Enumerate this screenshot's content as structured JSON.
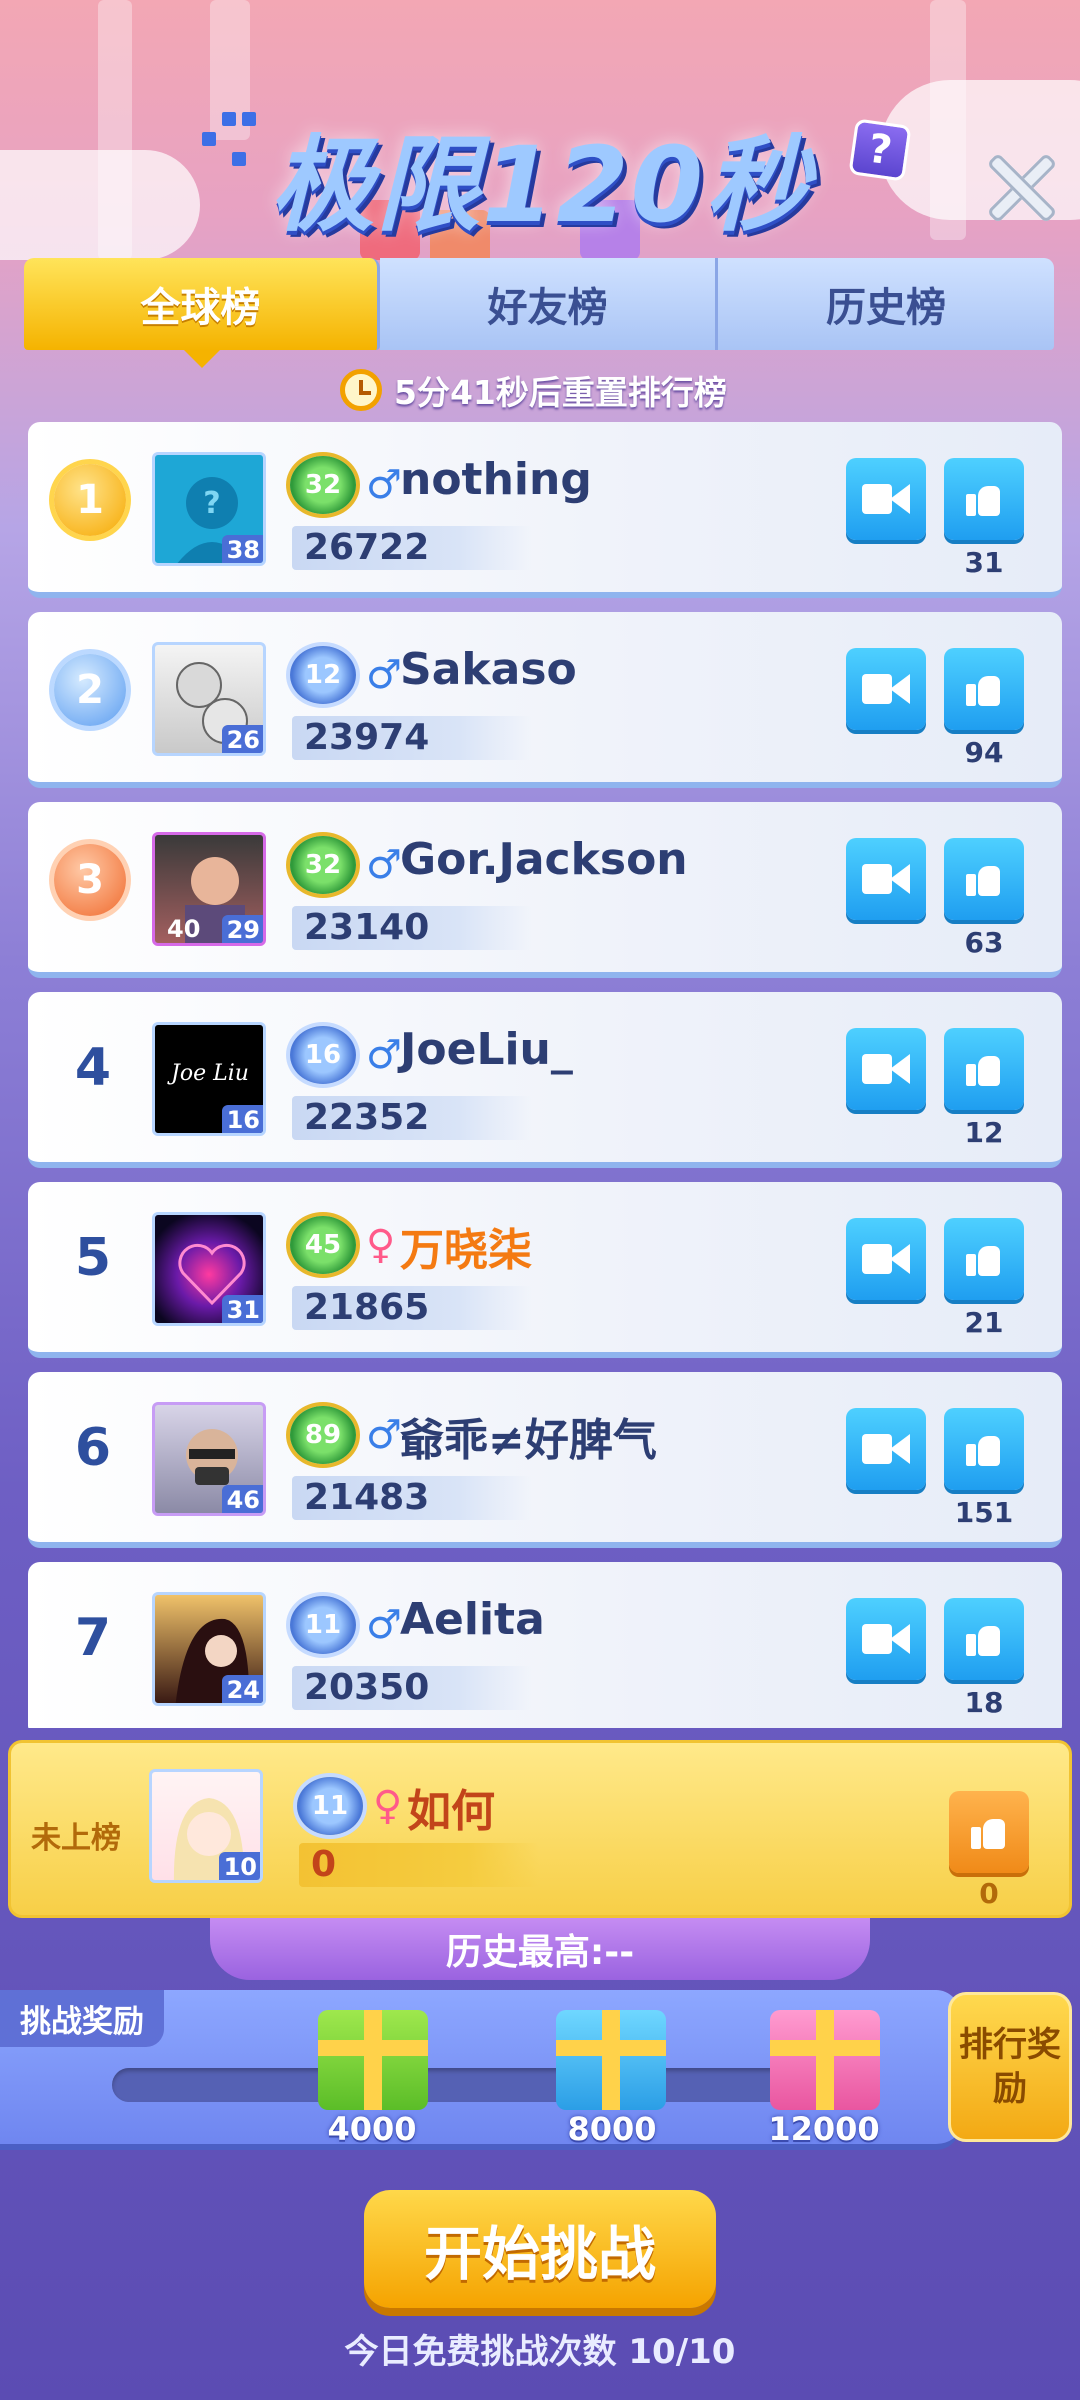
{
  "header": {
    "title": "极限120秒",
    "help_label": "?"
  },
  "tabs": [
    {
      "label": "全球榜",
      "active": true
    },
    {
      "label": "好友榜",
      "active": false
    },
    {
      "label": "历史榜",
      "active": false
    }
  ],
  "reset_notice": "5分41秒后重置排行榜",
  "players": [
    {
      "rank": "1",
      "medal": "gold",
      "avatar_level": "38",
      "level": "32",
      "gender": "♂",
      "name": "nothing",
      "score": "26722",
      "likes": "31"
    },
    {
      "rank": "2",
      "medal": "silver",
      "avatar_level": "26",
      "level": "12",
      "gender": "♂",
      "name": "Sakaso",
      "score": "23974",
      "likes": "94"
    },
    {
      "rank": "3",
      "medal": "bronze",
      "avatar_level": "29",
      "level": "32",
      "gender": "♂",
      "name": "Gor.Jackson",
      "score": "23140",
      "likes": "63"
    },
    {
      "rank": "4",
      "medal": "",
      "avatar_level": "16",
      "level": "16",
      "gender": "♂",
      "name": "JoeLiu_",
      "score": "22352",
      "likes": "12"
    },
    {
      "rank": "5",
      "medal": "",
      "avatar_level": "31",
      "level": "45",
      "gender": "♀",
      "name": "万晓柒",
      "score": "21865",
      "likes": "21"
    },
    {
      "rank": "6",
      "medal": "",
      "avatar_level": "46",
      "level": "89",
      "gender": "♂",
      "name": "爺乖≠好脾气",
      "score": "21483",
      "likes": "151"
    },
    {
      "rank": "7",
      "medal": "",
      "avatar_level": "24",
      "level": "11",
      "gender": "♂",
      "name": "Aelita",
      "score": "20350",
      "likes": "18"
    }
  ],
  "avatar3_extra": "40",
  "avatar4_text": "Joe Liu",
  "me": {
    "rank_label": "未上榜",
    "avatar_level": "10",
    "level": "11",
    "gender": "♀",
    "name": "如何",
    "score": "0",
    "likes": "0"
  },
  "history_best": "历史最高:--",
  "rewards": {
    "title": "挑战奖励",
    "thresholds": [
      "4000",
      "8000",
      "12000"
    ],
    "rank_reward_label": "排行奖励"
  },
  "start_button": "开始挑战",
  "free_attempts": "今日免费挑战次数 10/10",
  "colors": {
    "accent_yellow": "#f5b300",
    "accent_blue": "#1f9ef0",
    "name_dark": "#2d3e73",
    "name_orange": "#f47a12"
  }
}
